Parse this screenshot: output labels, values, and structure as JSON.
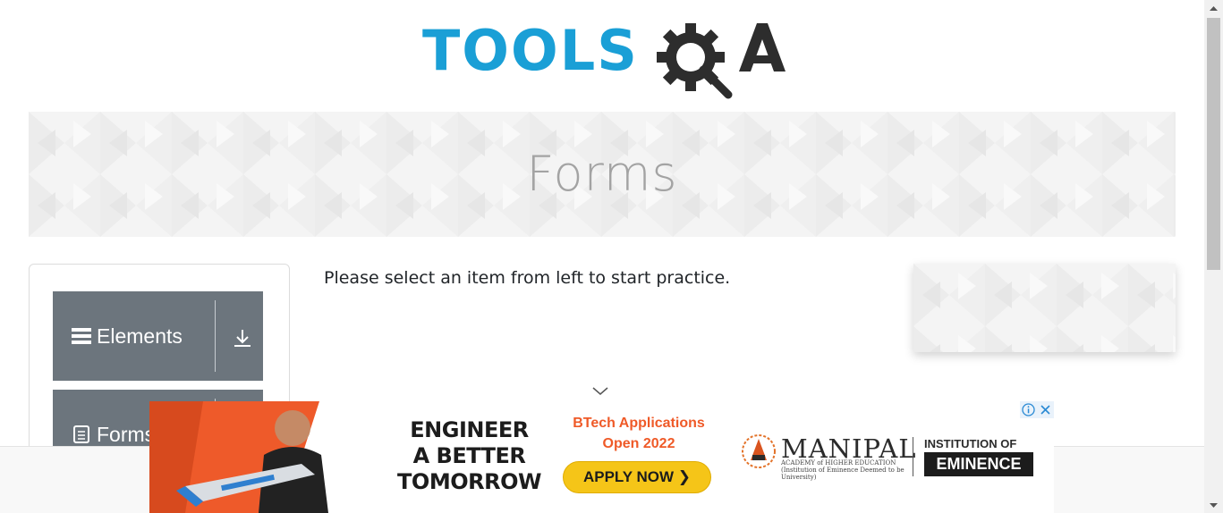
{
  "header": {
    "logo_alt": "TOOLSQA",
    "logo_text": "TOOLS",
    "logo_qa": "QA",
    "brand_color": "#1a9fd6"
  },
  "banner": {
    "title": "Forms"
  },
  "sidebar": {
    "groups": [
      {
        "label": "Elements",
        "icon": "hamburger-icon",
        "toggle_icon": "download-arrow-icon"
      },
      {
        "label": "Forms",
        "icon": "document-icon",
        "toggle_icon": "download-arrow-icon"
      }
    ],
    "group_color": "#6c757d"
  },
  "main": {
    "instruction": "Please select an item from left to start practice."
  },
  "ad": {
    "headline_line1": "ENGINEER",
    "headline_line2": "A BETTER",
    "headline_line3": "TOMORROW",
    "sub_line1": "BTech Applications",
    "sub_line2": "Open 2022",
    "cta": "APPLY NOW ❯",
    "brand": "MANIPAL",
    "brand_sub": "ACADEMY of HIGHER EDUCATION (Institution of Eminence Deemed to be University)",
    "institution_line": "INSTITUTION OF",
    "eminence": "EMINENCE",
    "accent_color": "#ef5a28",
    "cta_color": "#f5c518",
    "controls": [
      "info-icon",
      "close-icon"
    ]
  }
}
